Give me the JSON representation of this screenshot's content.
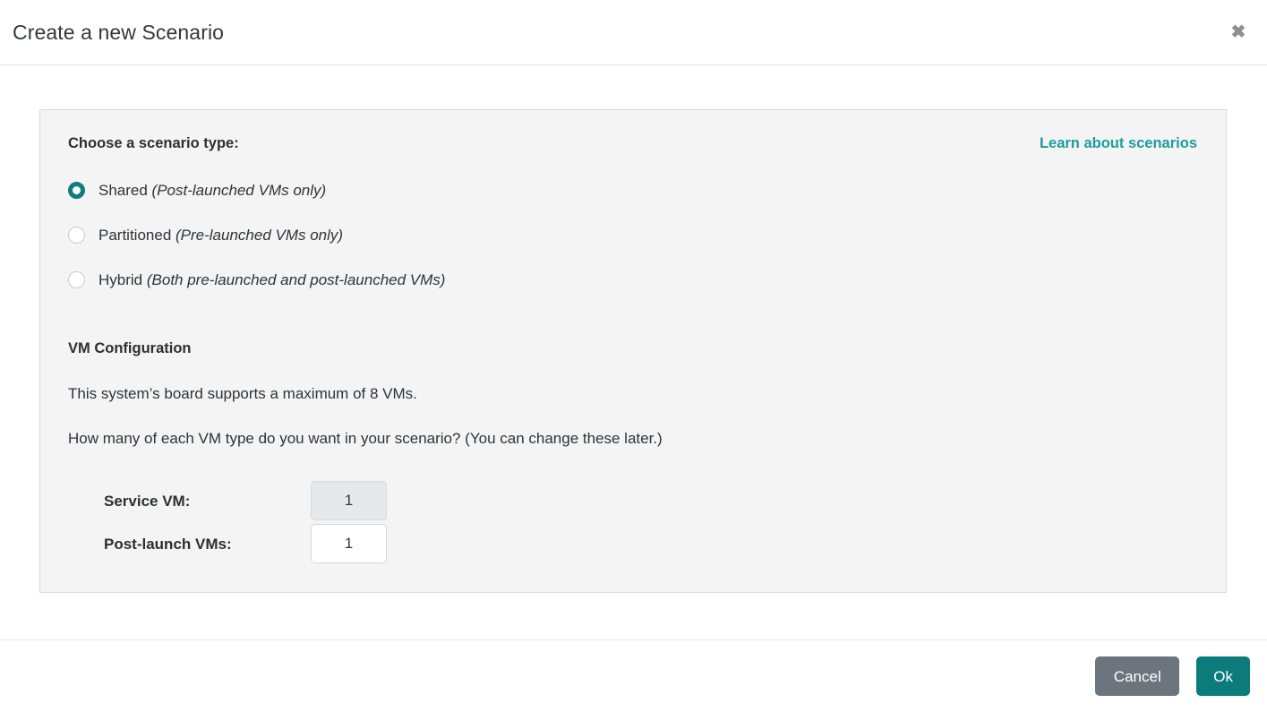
{
  "header": {
    "title": "Create a new Scenario",
    "close_icon": "close-icon",
    "close_glyph": "✖"
  },
  "panel": {
    "scenario_type_heading": "Choose a scenario type:",
    "learn_link": "Learn about scenarios",
    "scenario_types": [
      {
        "label": "Shared ",
        "hint": "(Post-launched VMs only)",
        "selected": true
      },
      {
        "label": "Partitioned ",
        "hint": "(Pre-launched VMs only)",
        "selected": false
      },
      {
        "label": "Hybrid ",
        "hint": "(Both pre-launched and post-launched VMs)",
        "selected": false
      }
    ],
    "vm_configuration": {
      "heading": "VM Configuration",
      "max_vms_text": "This system’s board supports a maximum of 8 VMs.",
      "prompt_text": "How many of each VM type do you want in your scenario? (You can change these later.)",
      "fields": [
        {
          "label": "Service VM:",
          "value": "1",
          "readonly": true
        },
        {
          "label": "Post-launch VMs:",
          "value": "1",
          "readonly": false
        }
      ]
    }
  },
  "footer": {
    "cancel_label": "Cancel",
    "ok_label": "Ok"
  },
  "colors": {
    "accent_teal": "#0d7d7d",
    "link_teal": "#1c9c9c",
    "ok_button": "#0c7b7b",
    "cancel_button": "#6c757d",
    "panel_bg": "#f4f4f4",
    "panel_border": "#d6d8da"
  }
}
